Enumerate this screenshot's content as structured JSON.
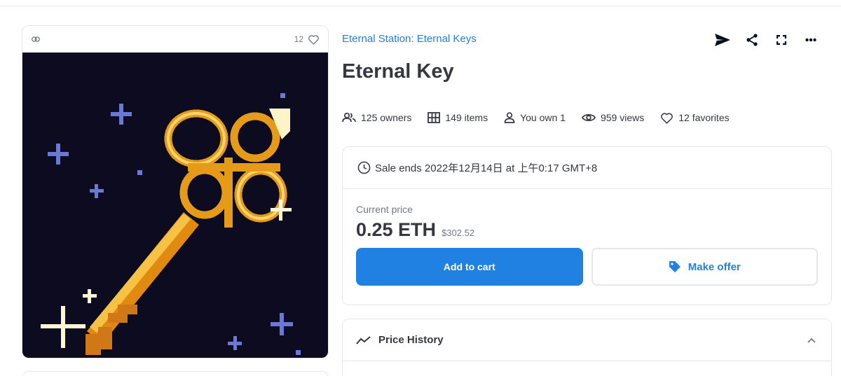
{
  "media": {
    "favorites_count": "12",
    "chain_icon": "link-icon",
    "favorite_icon": "heart-icon"
  },
  "item": {
    "collection": "Eternal Station: Eternal Keys",
    "title": "Eternal Key"
  },
  "actions": [
    {
      "icon": "send-icon"
    },
    {
      "icon": "share-icon"
    },
    {
      "icon": "fullscreen-icon"
    },
    {
      "icon": "more-icon"
    }
  ],
  "stats": {
    "owners": "125 owners",
    "items": "149 items",
    "you_own": "You own 1",
    "views": "959 views",
    "favorites": "12 favorites"
  },
  "sale": {
    "ends_text": "Sale ends 2022年12月14日 at 上午0:17 GMT+8",
    "current_price_label": "Current price",
    "price_eth": "0.25 ETH",
    "price_usd": "$302.52",
    "add_to_cart_label": "Add to cart",
    "make_offer_label": "Make offer"
  },
  "price_history": {
    "title": "Price History"
  },
  "colors": {
    "accent": "#2081e2",
    "text": "#353840",
    "muted": "#707a83",
    "border": "#e5e8eb",
    "nft_background": "#0d0b1f",
    "key_gold": "#f2a51a"
  }
}
